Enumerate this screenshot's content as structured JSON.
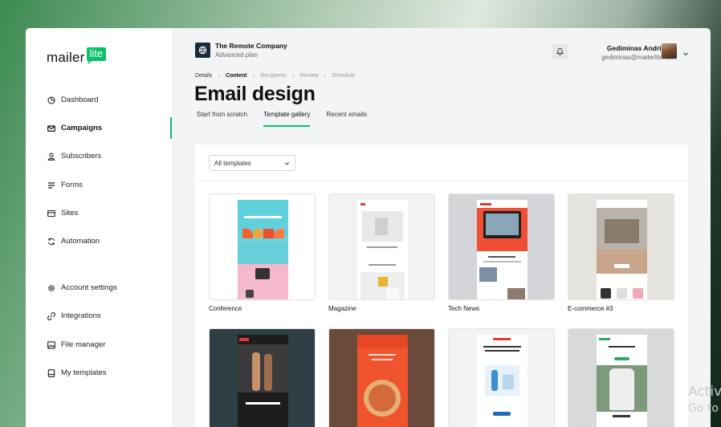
{
  "brand": {
    "logo_text": "mailer",
    "logo_badge": "lite",
    "accent": "#09c269"
  },
  "sidebar": {
    "items": [
      {
        "label": "Dashboard",
        "icon": "dashboard-icon"
      },
      {
        "label": "Campaigns",
        "icon": "mail-icon",
        "active": true
      },
      {
        "label": "Subscribers",
        "icon": "user-icon"
      },
      {
        "label": "Forms",
        "icon": "forms-icon"
      },
      {
        "label": "Sites",
        "icon": "sites-icon"
      },
      {
        "label": "Automation",
        "icon": "automation-icon"
      },
      {
        "label": "Account settings",
        "icon": "gear-icon"
      },
      {
        "label": "Integrations",
        "icon": "link-icon"
      },
      {
        "label": "File manager",
        "icon": "image-icon"
      },
      {
        "label": "My templates",
        "icon": "template-icon"
      }
    ]
  },
  "header": {
    "company_name": "The Remote Company",
    "company_plan": "Advanced plan",
    "user_name": "Gediminas Andrijaitis",
    "user_email": "gediminas@mailerlite.com"
  },
  "breadcrumb": [
    "Details",
    "Content",
    "Recipients",
    "Review",
    "Schedule"
  ],
  "page": {
    "title": "Email design"
  },
  "tabs": [
    "Start from scratch",
    "Template gallery",
    "Recent emails"
  ],
  "filter": {
    "selected": "All templates"
  },
  "templates": [
    {
      "label": "Conference"
    },
    {
      "label": "Magazine"
    },
    {
      "label": "Tech News"
    },
    {
      "label": "E-commerce #3"
    }
  ],
  "watermark": {
    "line1": "Activ",
    "line2": "Go to"
  }
}
